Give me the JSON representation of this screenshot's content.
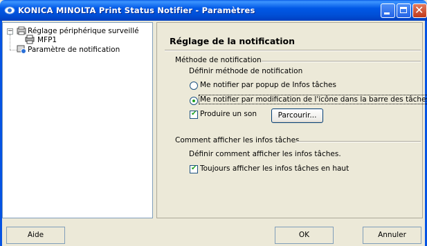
{
  "window": {
    "title": "KONICA MINOLTA Print Status Notifier - Paramètres",
    "colors": {
      "title_bar": "#0058e6",
      "close": "#c0391b"
    }
  },
  "tree": {
    "items": [
      {
        "label": "Réglage périphérique surveillé",
        "icon": "printer-group-icon",
        "expanded": true
      },
      {
        "label": "MFP1",
        "icon": "printer-icon"
      },
      {
        "label": "Paramètre de notification",
        "icon": "notification-settings-icon"
      }
    ]
  },
  "panel": {
    "title": "Réglage de la notification",
    "method_group": {
      "label": "Méthode de notification",
      "description": "Définir méthode de notification",
      "options": [
        {
          "label": "Me notifier par popup de Infos tâches",
          "checked": false
        },
        {
          "label": "Me notifier par modification de l'icône dans la barre des tâches",
          "checked": true
        }
      ],
      "sound": {
        "label": "Produire un son",
        "checked": true
      },
      "browse_label": "Parcourir..."
    },
    "display_group": {
      "label": "Comment afficher les infos tâches",
      "description": "Définir comment afficher les infos tâches.",
      "always_on_top": {
        "label": "Toujours afficher les infos tâches en haut",
        "checked": true
      }
    }
  },
  "footer": {
    "help_label": "Aide",
    "ok_label": "OK",
    "cancel_label": "Annuler"
  }
}
